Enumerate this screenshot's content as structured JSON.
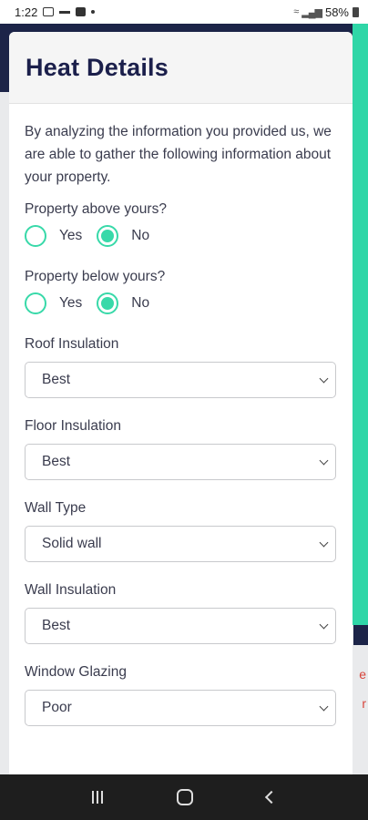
{
  "status_bar": {
    "time": "1:22",
    "battery_text": "58%",
    "icons": [
      "image-icon",
      "voicemail-icon",
      "chat-icon",
      "dot-icon",
      "wifi-icon",
      "signal-icon",
      "battery-icon"
    ]
  },
  "modal": {
    "title": "Heat Details",
    "intro": "By analyzing the information you provided us, we are able to gather the following information about your property.",
    "questions": [
      {
        "label": "Property above yours?",
        "options": [
          {
            "label": "Yes",
            "checked": false
          },
          {
            "label": "No",
            "checked": true
          }
        ]
      },
      {
        "label": "Property below yours?",
        "options": [
          {
            "label": "Yes",
            "checked": false
          },
          {
            "label": "No",
            "checked": true
          }
        ]
      }
    ],
    "selects": [
      {
        "label": "Roof Insulation",
        "value": "Best"
      },
      {
        "label": "Floor Insulation",
        "value": "Best"
      },
      {
        "label": "Wall Type",
        "value": "Solid wall"
      },
      {
        "label": "Wall Insulation",
        "value": "Best"
      },
      {
        "label": "Window Glazing",
        "value": "Poor"
      }
    ]
  },
  "colors": {
    "accent": "#38d9a9",
    "title": "#1b1f4b",
    "header_dark": "#1c2448"
  },
  "nav_bar": {
    "icons": [
      "recents-icon",
      "home-icon",
      "back-icon"
    ]
  }
}
